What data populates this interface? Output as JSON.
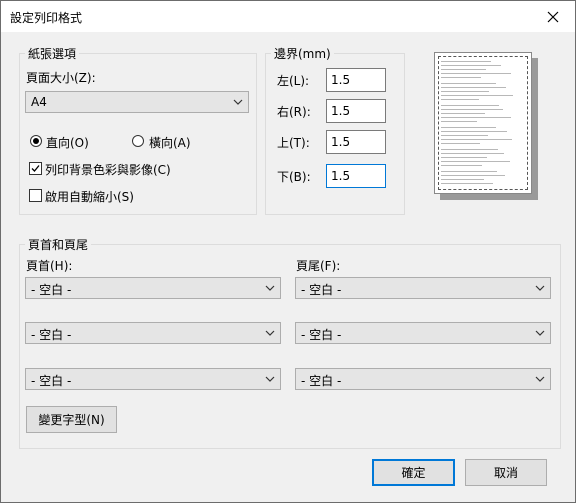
{
  "window": {
    "title": "設定列印格式"
  },
  "paper": {
    "group_label": "紙張選項",
    "size_label": "頁面大小(Z):",
    "size_value": "A4",
    "portrait_label": "直向(O)",
    "landscape_label": "橫向(A)",
    "orientation_selected": "portrait",
    "print_background_label": "列印背景色彩與影像(C)",
    "print_background_checked": true,
    "shrink_label": "啟用自動縮小(S)",
    "shrink_checked": false
  },
  "margins": {
    "group_label": "邊界(mm)",
    "left_label": "左(L):",
    "left_value": "1.5",
    "right_label": "右(R):",
    "right_value": "1.5",
    "top_label": "上(T):",
    "top_value": "1.5",
    "bottom_label": "下(B):",
    "bottom_value": "1.5"
  },
  "headers": {
    "group_label": "頁首和頁尾",
    "header_label": "頁首(H):",
    "footer_label": "頁尾(F):",
    "header_values": [
      "- 空白 -",
      "- 空白 -",
      "- 空白 -"
    ],
    "footer_values": [
      "- 空白 -",
      "- 空白 -",
      "- 空白 -"
    ],
    "change_font_label": "變更字型(N)"
  },
  "buttons": {
    "ok": "確定",
    "cancel": "取消"
  },
  "icons": {
    "close": "close-icon",
    "dropdown": "chevron-down-icon"
  }
}
